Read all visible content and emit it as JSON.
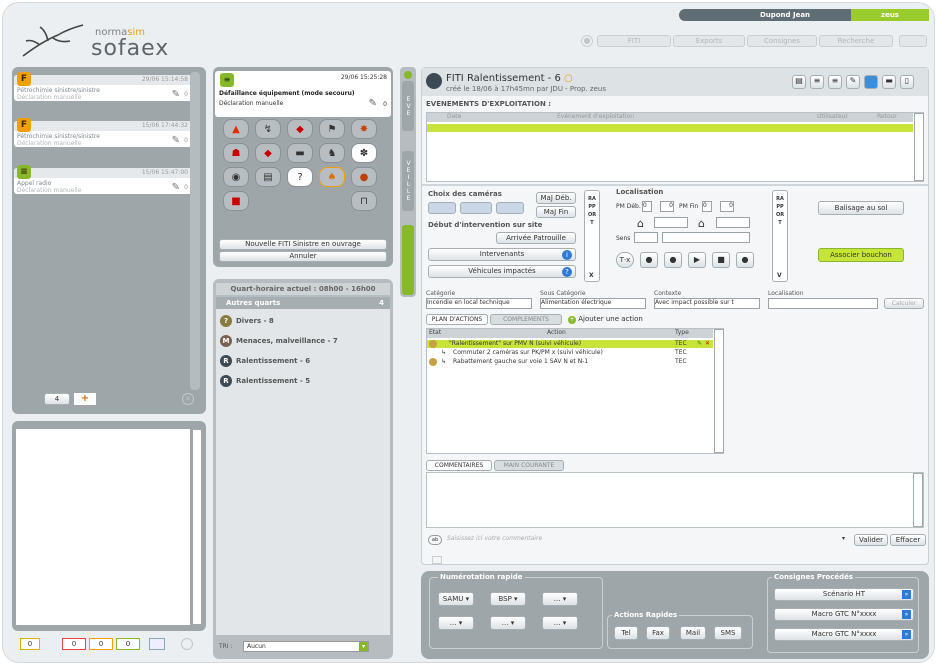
{
  "app": {
    "brand_small": "normasim",
    "brand_accent": "sim",
    "brand_prefix": "norma",
    "brand_large": "sofaex",
    "user": "Dupond Jean",
    "profile": "zeus",
    "nav_buttons": [
      "FITI",
      "Exports",
      "Consignes",
      "Recherche",
      ""
    ]
  },
  "left": {
    "cards": [
      {
        "time": "29/06 15:14:58",
        "line1": "Pétrochimie sinistre/sinistre",
        "line2": "Déclaration manuelle",
        "count": "0",
        "icon": "F",
        "color": "#f0a000"
      },
      {
        "time": "15/06 17:44:32",
        "line1": "Pétrochimie sinistre/sinistre",
        "line2": "Déclaration manuelle",
        "count": "0",
        "icon": "F",
        "color": "#f0a000"
      },
      {
        "time": "15/06 15:47:00",
        "line1": "Appel radio",
        "line2": "Déclaration manuelle",
        "count": "0",
        "icon": "≡",
        "color": "#86b82a"
      }
    ],
    "pager_value": "4",
    "pager_add": "+",
    "footer_counts": [
      "0",
      "0",
      "0",
      "0"
    ]
  },
  "middle": {
    "card": {
      "time": "29/06 15:25:28",
      "title": "Défaillance équipement (mode secouru)",
      "sub": "Déclaration manuelle",
      "count": "0"
    },
    "icons": [
      "fire-icon",
      "tow-icon",
      "vehicle-icon",
      "slow-icon",
      "accident-icon",
      "pedestrian-icon",
      "crash-icon",
      "car-icon",
      "animal-icon",
      "snow-icon",
      "jam-icon",
      "bus-icon",
      "unknown-icon",
      "roadwork-icon",
      "rubble-icon",
      "truck-icon",
      "",
      "",
      "",
      "barrier-icon"
    ],
    "btn_new": "Nouvelle FITI Sinistre en ouvrage",
    "btn_cancel": "Annuler",
    "quarter_header": "Quart-horaire actuel : 08h00 - 16h00",
    "group": "Autres quarts",
    "group_count": "4",
    "list": [
      {
        "label": "Divers - 8",
        "icon": "?"
      },
      {
        "label": "Menaces, malveillance - 7",
        "icon": "M"
      },
      {
        "label": "Ralentissement - 6",
        "icon": "R"
      },
      {
        "label": "Ralentissement - 5",
        "icon": "R"
      }
    ],
    "sort_label": "TRI :",
    "sort_value": "Aucun"
  },
  "vtabs": [
    "EVE",
    "VEILLE",
    ""
  ],
  "main": {
    "title": "FITI Ralentissement - 6",
    "subtitle": "créé le 18/06 à 17h45mn par JDU - Prop. zeus",
    "events_header": "EVENEMENTS D'EXPLOITATION :",
    "events_cols": [
      "Date",
      "Evénement d'exploitation",
      "Utilisateur",
      "Retour"
    ],
    "cam": {
      "title": "Choix des caméras",
      "maj_deb": "MaJ Déb.",
      "maj_fin": "MaJ Fin",
      "debut": "Début d'intervention sur site",
      "arrivee": "Arrivée Patrouille",
      "intervenants": "Intervenants",
      "vehicules": "Véhicules impactés"
    },
    "rapport": "RAPPORT",
    "rapport_x": "X",
    "rapport_v": "V",
    "loc": {
      "title": "Localisation",
      "pm_deb": "PM Déb.",
      "pm_fin": "PM Fin",
      "pm_val": "0",
      "sens": "Sens"
    },
    "balisage": "Balisage au sol",
    "associer": "Associer bouchon",
    "cat_labels": [
      "Catégorie",
      "Sous Catégorie",
      "Contexte",
      "Localisation"
    ],
    "cat_values": [
      "Incendie en local technique",
      "Alimentation électrique",
      "Avec impact possible sur t",
      ""
    ],
    "cat_button": "Calculer",
    "tabs": [
      "PLAN D'ACTIONS",
      "COMPLEMENTS"
    ],
    "add_action": "Ajouter une action",
    "plan_cols": [
      "Etat",
      "Action",
      "Type"
    ],
    "plan_rows": [
      {
        "action": "\"Ralentissement\" sur PMV N (suivi véhicule)",
        "type": "TEC"
      },
      {
        "action": "Commuter 2 caméras sur PK/PM x (suivi véhicule)",
        "type": "TEC"
      },
      {
        "action": "Rabattement gauche sur voie 1 SAV N et N-1",
        "type": "TEC"
      }
    ],
    "comment_tabs": [
      "COMMENTAIRES",
      "MAIN COURANTE"
    ],
    "comment_placeholder": "Saisissez ici votre commentaire",
    "valider": "Valider",
    "effacer": "Effacer"
  },
  "bottom": {
    "num_title": "Numérotation rapide",
    "num_selects": [
      "SAMU",
      "BSP",
      "...",
      "...",
      "...",
      "..."
    ],
    "act_title": "Actions Rapides",
    "act_buttons": [
      "Tel",
      "Fax",
      "Mail",
      "SMS"
    ],
    "cons_title": "Consignes Procédés",
    "cons_buttons": [
      "Scénario HT",
      "Macro GTC N°xxxx",
      "Macro GTC N°xxxx"
    ]
  },
  "colors": {
    "accent": "#9acb2c",
    "panel": "#9fa6aa",
    "highlight": "#c8e43a"
  }
}
